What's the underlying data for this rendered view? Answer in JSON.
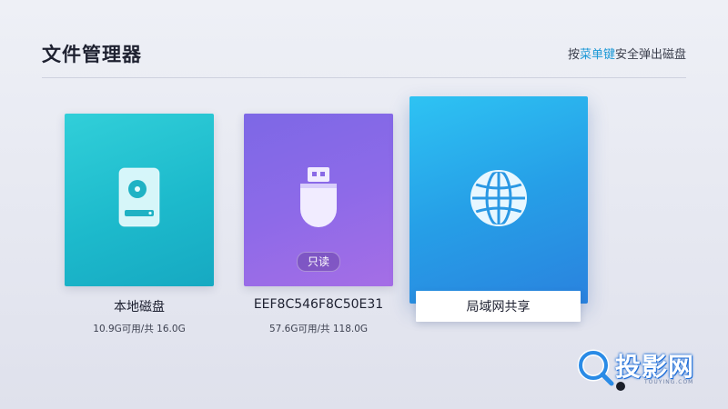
{
  "header": {
    "title": "文件管理器",
    "hint_prefix": "按",
    "hint_key": "菜单键",
    "hint_suffix": "安全弹出磁盘"
  },
  "devices": [
    {
      "name": "本地磁盘",
      "capacity": "10.9G可用/共 16.0G",
      "icon": "hard-disk-icon",
      "color": "#1dbacc"
    },
    {
      "name": "EEF8C546F8C50E31",
      "capacity": "57.6G可用/共 118.0G",
      "icon": "usb-drive-icon",
      "badge": "只读",
      "color": "#8d6ae8"
    },
    {
      "name": "局域网共享",
      "icon": "globe-icon",
      "color": "#269fe7",
      "selected": true
    }
  ],
  "watermark": {
    "text": "投影网",
    "sub": "TOUYING.COM"
  }
}
